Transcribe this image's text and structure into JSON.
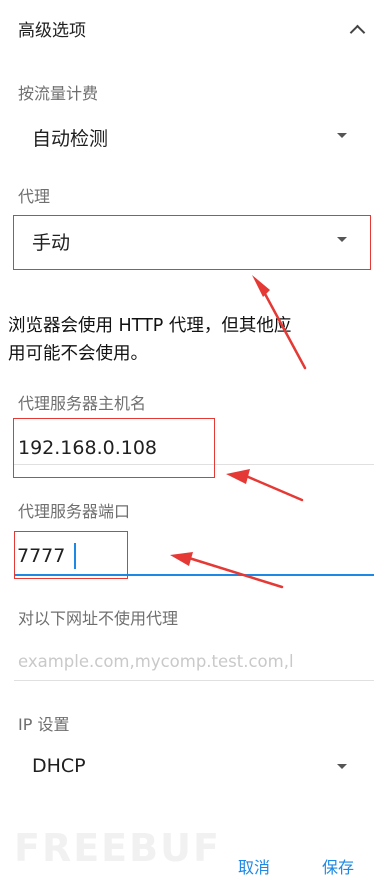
{
  "header": {
    "title": "高级选项",
    "collapse_icon": "chevron-up-icon"
  },
  "metered": {
    "label": "按流量计费",
    "value": "自动检测"
  },
  "proxy": {
    "label": "代理",
    "value": "手动"
  },
  "info_text": {
    "line1": "浏览器会使用 HTTP 代理，但其他应",
    "line2": "用可能不会使用。"
  },
  "hostname": {
    "label": "代理服务器主机名",
    "value": "192.168.0.108"
  },
  "port": {
    "label": "代理服务器端口",
    "value": "7777"
  },
  "bypass": {
    "label": "对以下网址不使用代理",
    "placeholder": "example.com,mycomp.test.com,l"
  },
  "ip": {
    "label": "IP 设置",
    "value": "DHCP"
  },
  "actions": {
    "cancel": "取消",
    "save": "保存"
  },
  "watermark": "FREEBUF",
  "colors": {
    "accent": "#1e88e5",
    "annotation": "#e53935"
  }
}
